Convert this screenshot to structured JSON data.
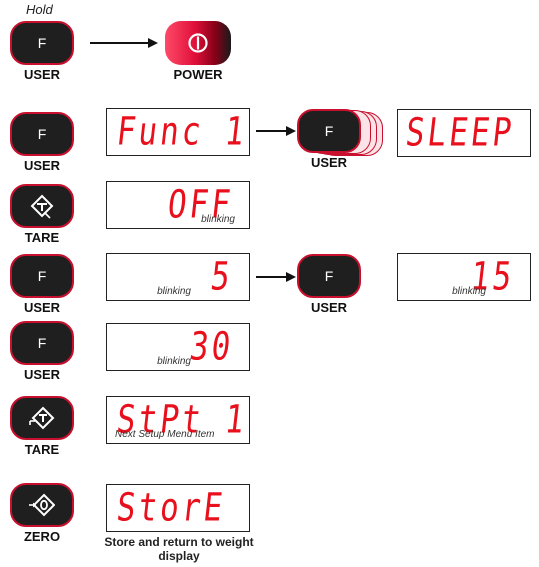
{
  "hold_text": "Hold",
  "key_f": "F",
  "labels": {
    "user": "USER",
    "power": "POWER",
    "tare": "TARE",
    "zero": "ZERO"
  },
  "displays": {
    "func1": "Func 1",
    "sleep": "SLEEP",
    "off": "OFF",
    "five": "5",
    "fifteen": "15",
    "thirty": "30",
    "stpt1": "StPt 1",
    "store": "StorE"
  },
  "notes": {
    "blinking": "blinking",
    "next_setup": "Next Setup Menu Item",
    "store_return": "Store and return to weight display"
  },
  "colors": {
    "button_border": "#c8102e",
    "segment_red": "#e8101c",
    "button_fill": "#1f1f1f"
  },
  "icons": [
    "power-icon",
    "tare-icon",
    "tare-setpoint-icon",
    "zero-icon",
    "arrow-right-icon"
  ]
}
